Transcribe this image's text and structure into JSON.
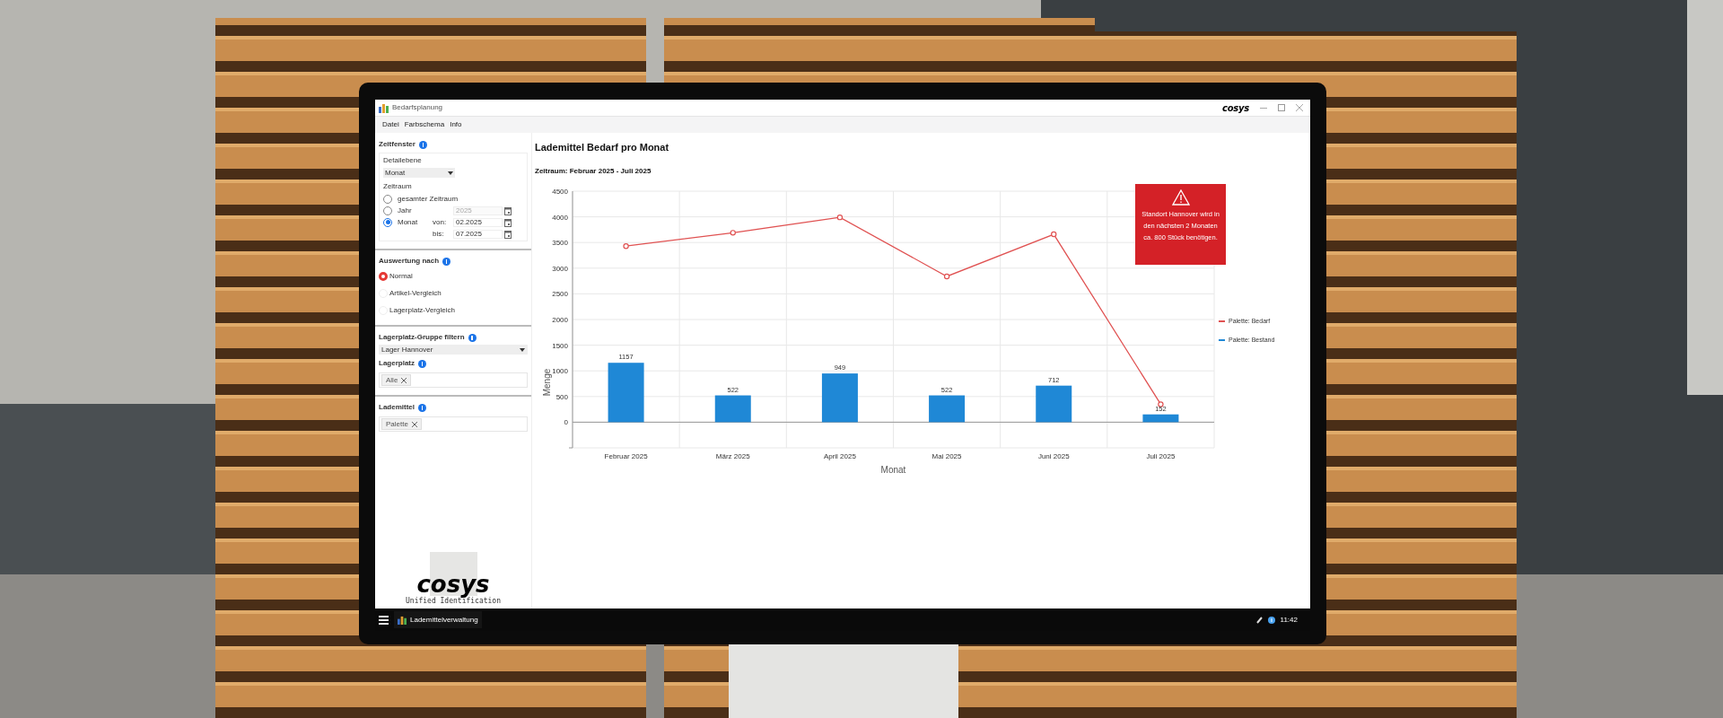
{
  "window": {
    "title": "Bedarfsplanung",
    "logo": "cosys"
  },
  "menu": [
    "Datei",
    "Farbschema",
    "Info"
  ],
  "sidebar": {
    "zeitfenster": {
      "heading": "Zeitfenster",
      "detail_label": "Detailebene",
      "detail_value": "Monat",
      "zeitraum_label": "Zeitraum",
      "options": [
        {
          "label": "gesamter Zeitraum",
          "selected": false
        },
        {
          "label": "Jahr",
          "selected": false,
          "fields": [
            {
              "value": "2025",
              "disabled": true
            }
          ]
        },
        {
          "label": "Monat",
          "selected": true,
          "fields": [
            {
              "label": "von:",
              "value": "02.2025",
              "disabled": false
            },
            {
              "label": "bis:",
              "value": "07.2025",
              "disabled": false
            }
          ]
        }
      ]
    },
    "auswertung": {
      "heading": "Auswertung nach",
      "options": [
        {
          "label": "Normal",
          "selected": true
        },
        {
          "label": "Artikel-Vergleich",
          "selected": false
        },
        {
          "label": "Lagerplatz-Vergleich",
          "selected": false
        }
      ]
    },
    "gruppe": {
      "heading": "Lagerplatz-Gruppe filtern",
      "value": "Lager Hannover"
    },
    "lagerplatz": {
      "heading": "Lagerplatz",
      "tags": [
        "Alle"
      ]
    },
    "lademittel": {
      "heading": "Lademittel",
      "tags": [
        "Palette"
      ]
    },
    "logo": {
      "text": "cosys",
      "tagline": "Unified Identification"
    }
  },
  "main": {
    "title": "Lademittel Bedarf pro Monat",
    "subtitle": "Zeitraum: Februar 2025 - Juli 2025",
    "chart_data": {
      "type": "bar",
      "xlabel": "Monat",
      "ylabel": "Menge",
      "categories": [
        "Februar 2025",
        "März 2025",
        "April 2025",
        "Mai 2025",
        "Juni 2025",
        "Juli 2025"
      ],
      "series": [
        {
          "name": "Palette: Bedarf",
          "type": "line",
          "marker": "circle",
          "color": "#e05252",
          "values": [
            3430,
            3690,
            3990,
            2840,
            3660,
            350
          ]
        },
        {
          "name": "Palette: Bestand",
          "type": "bar",
          "color": "#1f88d6",
          "values": [
            1157,
            522,
            949,
            522,
            712,
            152
          ],
          "value_labels": [
            "1157",
            "522",
            "949",
            "522",
            "712",
            "152"
          ]
        }
      ],
      "ylim": [
        -500,
        4500
      ],
      "yticks": [
        0,
        500,
        1000,
        1500,
        2000,
        2500,
        3000,
        3500,
        4000,
        4500
      ],
      "grid": true
    },
    "alert": {
      "text": "Standort Hannover wird in den nächsten 2 Monaten ca. 800 Stück benötigen."
    }
  },
  "taskbar": {
    "app": "Lademittelverwaltung",
    "time": "11:42"
  }
}
